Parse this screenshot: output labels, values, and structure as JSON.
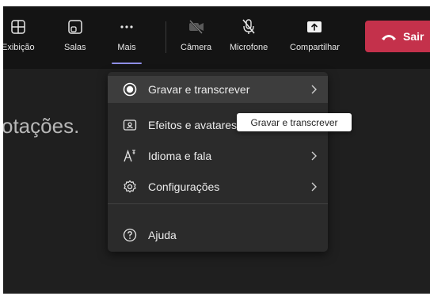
{
  "toolbar": {
    "items": [
      {
        "label": "Exibição",
        "icon": "layout-icon"
      },
      {
        "label": "Salas",
        "icon": "breakout-rooms-icon"
      },
      {
        "label": "Mais",
        "icon": "more-icon"
      },
      {
        "label": "Câmera",
        "icon": "camera-off-icon"
      },
      {
        "label": "Microfone",
        "icon": "mic-off-icon"
      },
      {
        "label": "Compartilhar",
        "icon": "share-icon"
      }
    ],
    "leave_label": "Sair",
    "leave_color": "#c4314b",
    "active_indicator_color": "#8f8fe6"
  },
  "background_text": "otações.",
  "menu": {
    "items": [
      {
        "label": "Gravar e transcrever",
        "icon": "record-icon",
        "submenu": true
      },
      {
        "label": "Efeitos e avatares",
        "icon": "effects-icon",
        "submenu": true
      },
      {
        "label": "Idioma e fala",
        "icon": "language-icon",
        "submenu": true
      },
      {
        "label": "Configurações",
        "icon": "gear-icon",
        "submenu": true
      },
      {
        "label": "Ajuda",
        "icon": "help-icon",
        "submenu": false
      }
    ]
  },
  "tooltip": {
    "text": "Gravar e transcrever"
  }
}
